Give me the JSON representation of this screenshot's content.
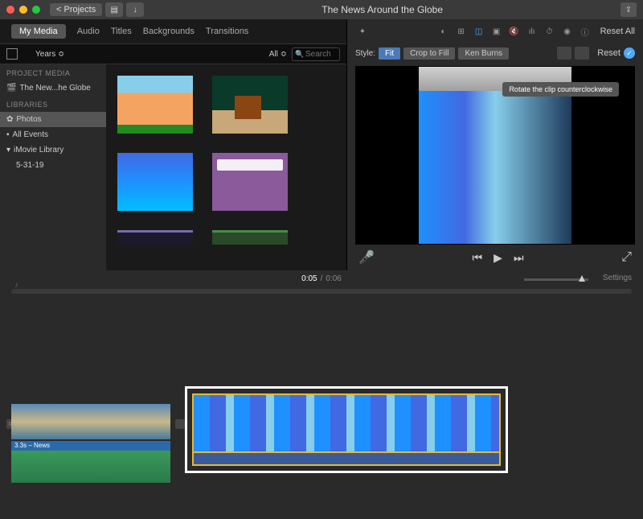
{
  "titlebar": {
    "projects_label": "Projects",
    "title": "The News Around the Globe"
  },
  "tabs": {
    "my_media": "My Media",
    "audio": "Audio",
    "titles": "Titles",
    "backgrounds": "Backgrounds",
    "transitions": "Transitions"
  },
  "filter": {
    "years": "Years",
    "all": "All",
    "search_placeholder": "Search"
  },
  "sidebar": {
    "project_media_hdr": "PROJECT MEDIA",
    "project_item": "The New...he Globe",
    "libraries_hdr": "LIBRARIES",
    "photos": "Photos",
    "all_events": "All Events",
    "imovie_lib": "iMovie Library",
    "date_item": "5-31-19"
  },
  "fx": {
    "reset_all": "Reset All",
    "style_label": "Style:",
    "fit": "Fit",
    "crop": "Crop to Fill",
    "ken": "Ken Burns",
    "reset": "Reset"
  },
  "viewer": {
    "tooltip": "Rotate the clip counterclockwise"
  },
  "time": {
    "current": "0:05",
    "total": "0:06",
    "sep": " / ",
    "settings": "Settings"
  },
  "timeline": {
    "audio_clip_label": "3.3s – News"
  }
}
